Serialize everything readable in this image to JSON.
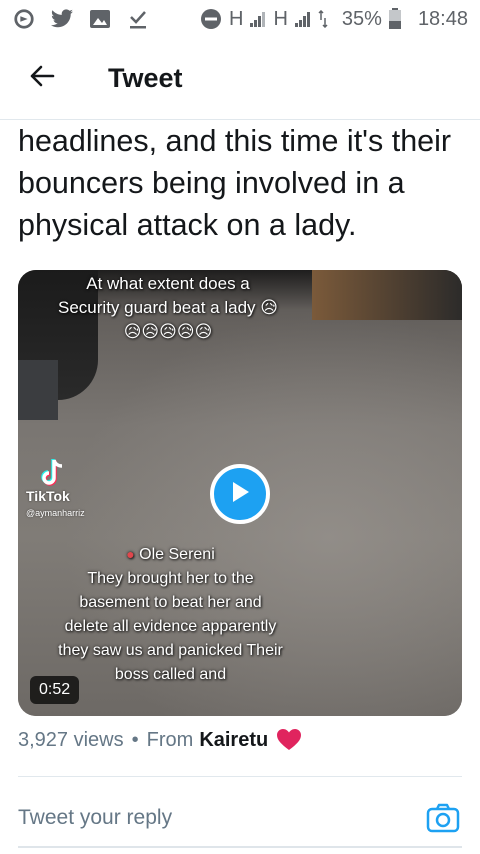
{
  "status_bar": {
    "network_1": "H",
    "network_2": "H",
    "battery": "35%",
    "time": "18:48",
    "icons": [
      "vpn-icon",
      "twitter-icon",
      "gallery-icon",
      "download-done-icon",
      "do-not-disturb-icon",
      "signal-icon",
      "signal-icon",
      "data-arrows-icon",
      "battery-icon"
    ]
  },
  "app_bar": {
    "title": "Tweet",
    "back_icon": "arrow-left-icon"
  },
  "tweet": {
    "text": "headlines, and this time it's their bouncers being involved in a physical attack on a lady.",
    "media": {
      "caption_top": "At what extent does a Security guard beat a lady 😥😥😥😥😥😥",
      "location": "Ole Sereni",
      "caption_body": "They brought her to the basement to beat her and delete all evidence apparently they saw us and panicked Their boss called and",
      "tiktok_label": "TikTok",
      "tiktok_handle": "@aymanharriz",
      "duration": "0:52",
      "play_icon": "play-icon"
    },
    "views": "3,927 views",
    "separator": "•",
    "from_label": "From",
    "from_user": "Kairetu",
    "heart_icon": "heart-icon"
  },
  "reply": {
    "placeholder": "Tweet your reply",
    "camera_icon": "camera-icon"
  },
  "colors": {
    "accent": "#1da1f2",
    "text_primary": "#14171a",
    "text_secondary": "#657786",
    "heart": "#e0245e"
  }
}
